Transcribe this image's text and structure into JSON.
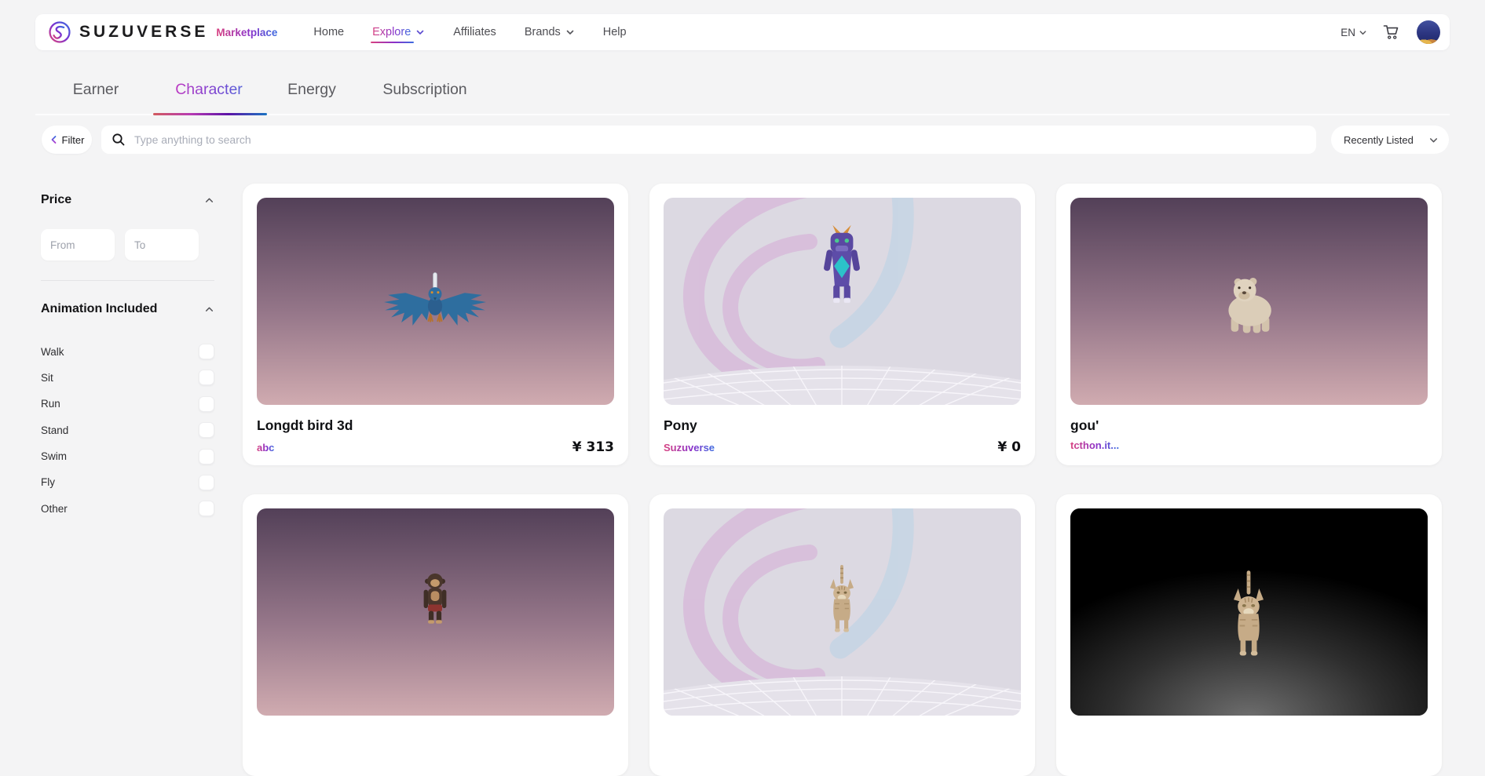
{
  "colors": {
    "accent_gradient": [
      "#d9427f",
      "#8b2fc9",
      "#3b6ce0"
    ],
    "page_background": "#f4f4f5",
    "surface": "#ffffff"
  },
  "icons": {
    "logo": "s-swirl-ring",
    "search": "magnifier",
    "cart": "shopping-cart",
    "chevron_down": "v",
    "chevron_up": "^",
    "chevron_left": "<"
  },
  "navbar": {
    "brand": {
      "name": "SUZUVERSE",
      "suffix": "Marketplace"
    },
    "links": [
      {
        "label": "Home"
      },
      {
        "label": "Explore",
        "active": true,
        "dropdown": true
      },
      {
        "label": "Affiliates"
      },
      {
        "label": "Brands",
        "dropdown": true
      },
      {
        "label": "Help"
      }
    ],
    "language": "EN"
  },
  "tabs": [
    {
      "label": "Earner"
    },
    {
      "label": "Character",
      "active": true
    },
    {
      "label": "Energy"
    },
    {
      "label": "Subscription"
    }
  ],
  "toolbar": {
    "filter_label": "Filter",
    "search_placeholder": "Type anything to search",
    "sort_label": "Recently Listed"
  },
  "sidebar": {
    "price": {
      "title": "Price",
      "from_placeholder": "From",
      "to_placeholder": "To"
    },
    "animation": {
      "title": "Animation Included",
      "options": [
        "Walk",
        "Sit",
        "Run",
        "Stand",
        "Swim",
        "Fly",
        "Other"
      ]
    }
  },
  "cards": [
    {
      "title": "Longdt bird 3d",
      "author": "abc",
      "price": "¥ 313"
    },
    {
      "title": "Pony",
      "author": "Suzuverse",
      "price": "¥ 0"
    },
    {
      "title": "gou'",
      "author": "tcthon.it..."
    }
  ]
}
